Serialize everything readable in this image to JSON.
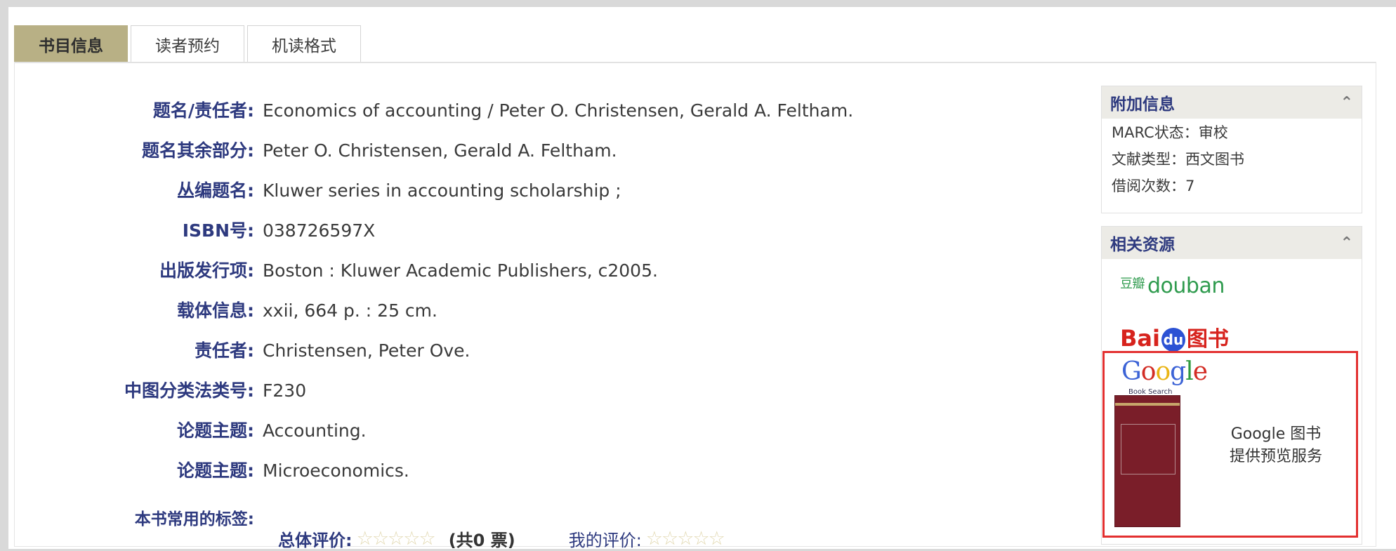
{
  "tabs": [
    {
      "label": "书目信息",
      "active": true
    },
    {
      "label": "读者预约",
      "active": false
    },
    {
      "label": "机读格式",
      "active": false
    }
  ],
  "fields": [
    {
      "label": "题名/责任者:",
      "value": "Economics of accounting / Peter O. Christensen, Gerald A. Feltham."
    },
    {
      "label": "题名其余部分:",
      "value": "Peter O. Christensen, Gerald A. Feltham."
    },
    {
      "label": "丛编题名:",
      "value": "Kluwer series in accounting scholarship ;"
    },
    {
      "label": "ISBN号:",
      "value": "038726597X"
    },
    {
      "label": "出版发行项:",
      "value": "Boston : Kluwer Academic Publishers, c2005."
    },
    {
      "label": "载体信息:",
      "value": "xxii, 664 p. : 25 cm."
    },
    {
      "label": "责任者:",
      "value": "Christensen, Peter Ove."
    },
    {
      "label": "中图分类法类号:",
      "value": "F230"
    },
    {
      "label": "论题主题:",
      "value": "Accounting."
    },
    {
      "label": "论题主题:",
      "value": "Microeconomics."
    }
  ],
  "tags": {
    "label": "本书常用的标签:",
    "overall_label": "总体评价:",
    "overall_stars": 0,
    "vote_count": "(共0 票)",
    "my_label": "我的评价:",
    "my_stars": 0
  },
  "extra_info": {
    "title": "附加信息",
    "lines": [
      "MARC状态：审校",
      "文献类型：西文图书",
      "借阅次数：7"
    ]
  },
  "related": {
    "title": "相关资源",
    "douban_cn": "豆瓣",
    "douban_en": "douban",
    "baidu_left": "Bai",
    "baidu_du": "du",
    "baidu_book": "图书",
    "google_sub": "Book Search",
    "google_text_line1": "Google 图书",
    "google_text_line2": "提供预览服务"
  },
  "icons": {
    "collapse": "double-chevron-up-icon",
    "star": "star-icon"
  }
}
